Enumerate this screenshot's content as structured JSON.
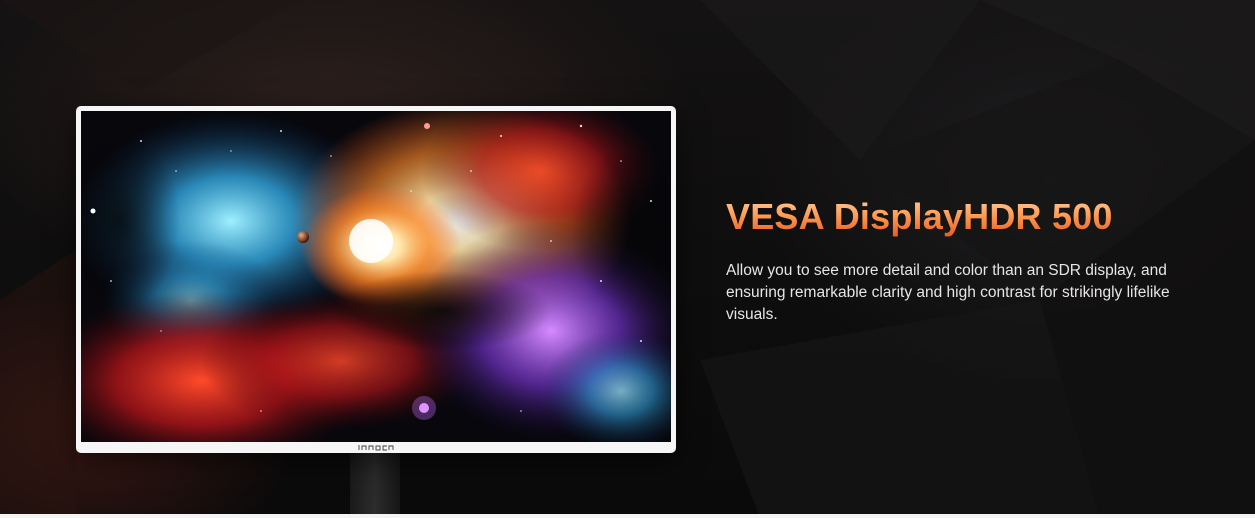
{
  "banner": {
    "headline": "VESA DisplayHDR 500",
    "description": "Allow you to see more detail and color than an SDR display, and ensuring remarkable clarity and high contrast for strikingly lifelike visuals.",
    "headline_color": "#f47a2e",
    "text_color": "#e6e6e6",
    "background_color": "#0c0b0b"
  },
  "monitor": {
    "brand_logo": "innocn",
    "bezel_color": "#f6f6f6",
    "screen_image": "nebula-galaxy-wallpaper"
  }
}
